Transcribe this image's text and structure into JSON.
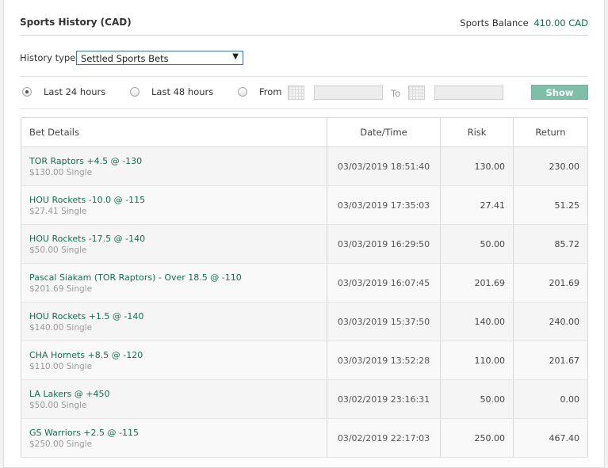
{
  "header": {
    "title": "Sports History (CAD)",
    "balance_label": "Sports Balance",
    "balance_amount": "410.00 CAD"
  },
  "history_type": {
    "label": "History type",
    "selected": "Settled Sports Bets"
  },
  "filter": {
    "opt_24": "Last 24 hours",
    "opt_48": "Last 48 hours",
    "from_label": "From",
    "to_label": "To",
    "show_button": "Show",
    "selected": "Last 24 hours"
  },
  "table": {
    "headers": [
      "Bet Details",
      "Date/Time",
      "Risk",
      "Return"
    ],
    "rows": [
      {
        "selection": "TOR Raptors +4.5 @ -130",
        "stake": "$130.00 Single",
        "datetime": "03/03/2019 18:51:40",
        "risk": "130.00",
        "return": "230.00"
      },
      {
        "selection": "HOU Rockets -10.0 @ -115",
        "stake": "$27.41 Single",
        "datetime": "03/03/2019 17:35:03",
        "risk": "27.41",
        "return": "51.25"
      },
      {
        "selection": "HOU Rockets -17.5 @ -140",
        "stake": "$50.00 Single",
        "datetime": "03/03/2019 16:29:50",
        "risk": "50.00",
        "return": "85.72"
      },
      {
        "selection": "Pascal Siakam (TOR Raptors) - Over 18.5 @ -110",
        "stake": "$201.69 Single",
        "datetime": "03/03/2019 16:07:45",
        "risk": "201.69",
        "return": "201.69"
      },
      {
        "selection": "HOU Rockets +1.5 @ -140",
        "stake": "$140.00 Single",
        "datetime": "03/03/2019 15:37:50",
        "risk": "140.00",
        "return": "240.00"
      },
      {
        "selection": "CHA Hornets +8.5 @ -120",
        "stake": "$110.00 Single",
        "datetime": "03/03/2019 13:52:28",
        "risk": "110.00",
        "return": "201.67"
      },
      {
        "selection": "LA Lakers @ +450",
        "stake": "$50.00 Single",
        "datetime": "03/02/2019 23:16:31",
        "risk": "50.00",
        "return": "0.00"
      },
      {
        "selection": "GS Warriors +2.5 @ -115",
        "stake": "$250.00 Single",
        "datetime": "03/02/2019 22:17:03",
        "risk": "250.00",
        "return": "467.40"
      }
    ]
  }
}
